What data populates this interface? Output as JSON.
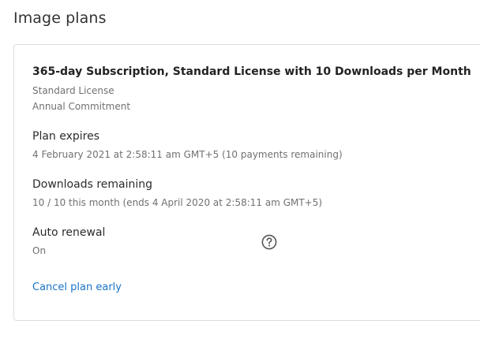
{
  "page": {
    "title": "Image plans"
  },
  "plan": {
    "name": "365-day Subscription, Standard License with 10 Downloads per Month",
    "license": "Standard License",
    "commitment": "Annual Commitment",
    "expires": {
      "label": "Plan expires",
      "value": "4 February 2021 at 2:58:11 am GMT+5 (10 payments remaining)"
    },
    "downloads": {
      "label": "Downloads remaining",
      "value": "10 / 10 this month (ends 4 April 2020 at 2:58:11 am GMT+5)"
    },
    "auto_renewal": {
      "label": "Auto renewal",
      "value": "On",
      "help_icon": "question-circle-icon"
    },
    "cancel_label": "Cancel plan early"
  },
  "colors": {
    "link": "#1a73c7",
    "muted_text": "#707070",
    "border": "#dddddd"
  }
}
